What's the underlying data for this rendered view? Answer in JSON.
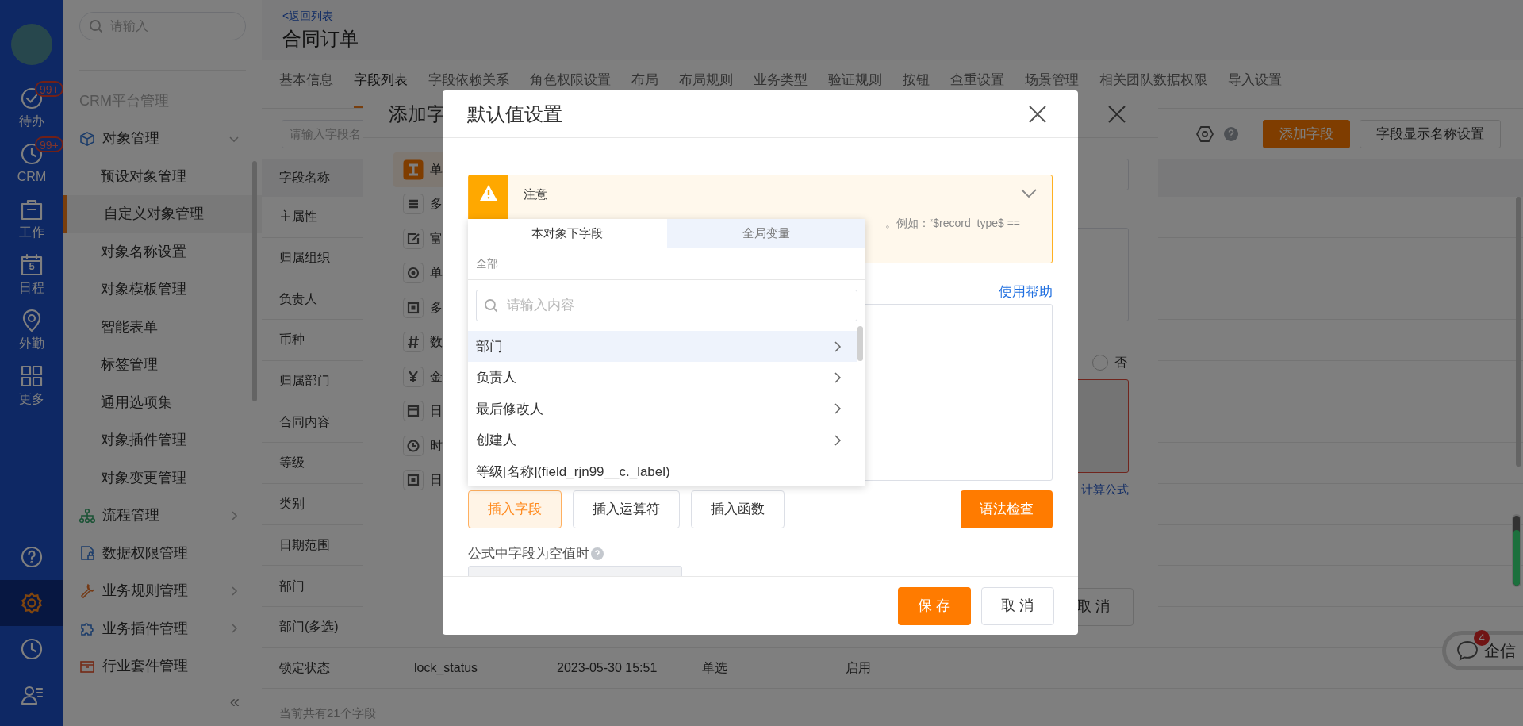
{
  "rail": {
    "items": [
      {
        "label": "待办",
        "badge": "99+"
      },
      {
        "label": "CRM",
        "badge": "99+"
      },
      {
        "label": "工作"
      },
      {
        "label": "日程",
        "day": "5"
      },
      {
        "label": "外勤"
      },
      {
        "label": "更多"
      }
    ],
    "bottom": [
      {
        "selected": false
      },
      {
        "selected": true
      },
      {
        "selected": false
      },
      {
        "selected": false
      }
    ]
  },
  "sidebar": {
    "search_placeholder": "请输入",
    "section": "CRM平台管理",
    "items": [
      {
        "label": "对象管理",
        "expanded": true,
        "children": [
          {
            "label": "预设对象管理",
            "selected": false
          },
          {
            "label": "自定义对象管理",
            "selected": true
          },
          {
            "label": "对象名称设置",
            "selected": false
          },
          {
            "label": "对象模板管理",
            "selected": false
          },
          {
            "label": "智能表单",
            "selected": false
          },
          {
            "label": "标签管理",
            "selected": false
          },
          {
            "label": "通用选项集",
            "selected": false
          },
          {
            "label": "对象插件管理",
            "selected": false
          },
          {
            "label": "对象变更管理",
            "selected": false
          }
        ]
      },
      {
        "label": "流程管理",
        "expanded": false
      },
      {
        "label": "数据权限管理"
      },
      {
        "label": "业务规则管理",
        "expanded": false
      },
      {
        "label": "业务插件管理",
        "expanded": false
      },
      {
        "label": "行业套件管理"
      }
    ],
    "collapse": "«"
  },
  "header": {
    "back_link": "<返回列表",
    "title": "合同订单"
  },
  "tabs": [
    {
      "label": "基本信息",
      "selected": false
    },
    {
      "label": "字段列表",
      "selected": true
    },
    {
      "label": "字段依赖关系",
      "selected": false
    },
    {
      "label": "角色权限设置",
      "selected": false
    },
    {
      "label": "布局",
      "selected": false
    },
    {
      "label": "布局规则",
      "selected": false
    },
    {
      "label": "业务类型",
      "selected": false
    },
    {
      "label": "验证规则",
      "selected": false
    },
    {
      "label": "按钮",
      "selected": false
    },
    {
      "label": "查重设置",
      "selected": false
    },
    {
      "label": "场景管理",
      "selected": false
    },
    {
      "label": "相关团队数据权限",
      "selected": false
    },
    {
      "label": "导入设置",
      "selected": false
    }
  ],
  "toolbar": {
    "search_placeholder": "请输入字段名",
    "buttons": [
      {
        "label": "添加字段",
        "kind": "primary"
      },
      {
        "label": "字段显示名称设置",
        "kind": "default"
      }
    ]
  },
  "table": {
    "columns": [
      "字段名称"
    ],
    "rows": [
      [
        "主属性"
      ],
      [
        "归属组织"
      ],
      [
        "负责人"
      ],
      [
        "币种"
      ],
      [
        "归属部门"
      ],
      [
        "合同内容"
      ],
      [
        "等级"
      ],
      [
        "类别"
      ],
      [
        "日期范围"
      ],
      [
        "部门"
      ],
      [
        "部门(多选)"
      ],
      [
        "锁定状态",
        "lock_status",
        "2023-05-30 15:51",
        "单选",
        "启用"
      ]
    ],
    "footer": "当前共有21个字段"
  },
  "add_field_dialog": {
    "title": "添加字",
    "types": [
      {
        "label": "单",
        "selected": true
      },
      {
        "label": "多",
        "selected": false
      },
      {
        "label": "富",
        "selected": false
      },
      {
        "label": "单",
        "selected": false
      },
      {
        "label": "多",
        "selected": false
      },
      {
        "label": "数",
        "selected": false
      },
      {
        "label": "金",
        "selected": false
      },
      {
        "label": "日",
        "selected": false
      },
      {
        "label": "时",
        "selected": false
      },
      {
        "label": "日",
        "selected": false
      }
    ],
    "radio": {
      "label": "否",
      "checked": false
    },
    "formula_link": "计算公式",
    "cancel": "取 消"
  },
  "default_dialog": {
    "title": "默认值设置",
    "notice": {
      "title": "注意",
      "text": "。例如：“$record_type$ ==",
      "expanded": false
    },
    "help_link": "使用帮助",
    "insert_buttons": [
      {
        "label": "插入字段",
        "selected": true
      },
      {
        "label": "插入运算符",
        "selected": false
      },
      {
        "label": "插入函数",
        "selected": false
      }
    ],
    "check_button": "语法检查",
    "null_label": "公式中字段为空值时",
    "save": "保 存",
    "cancel": "取 消"
  },
  "field_picker": {
    "tabs": [
      {
        "label": "本对象下字段",
        "selected": true
      },
      {
        "label": "全局变量",
        "selected": false
      }
    ],
    "breadcrumb": "全部",
    "search_placeholder": "请输入内容",
    "items": [
      {
        "label": "部门",
        "kind": "group",
        "selected": true
      },
      {
        "label": "负责人",
        "kind": "group",
        "selected": false
      },
      {
        "label": "最后修改人",
        "kind": "group",
        "selected": false
      },
      {
        "label": "创建人",
        "kind": "group",
        "selected": false
      },
      {
        "label": "等级[名称](field_rjn99__c._label)",
        "kind": "field",
        "selected": false
      }
    ]
  },
  "chat": {
    "label": "企信",
    "badge": "4"
  }
}
